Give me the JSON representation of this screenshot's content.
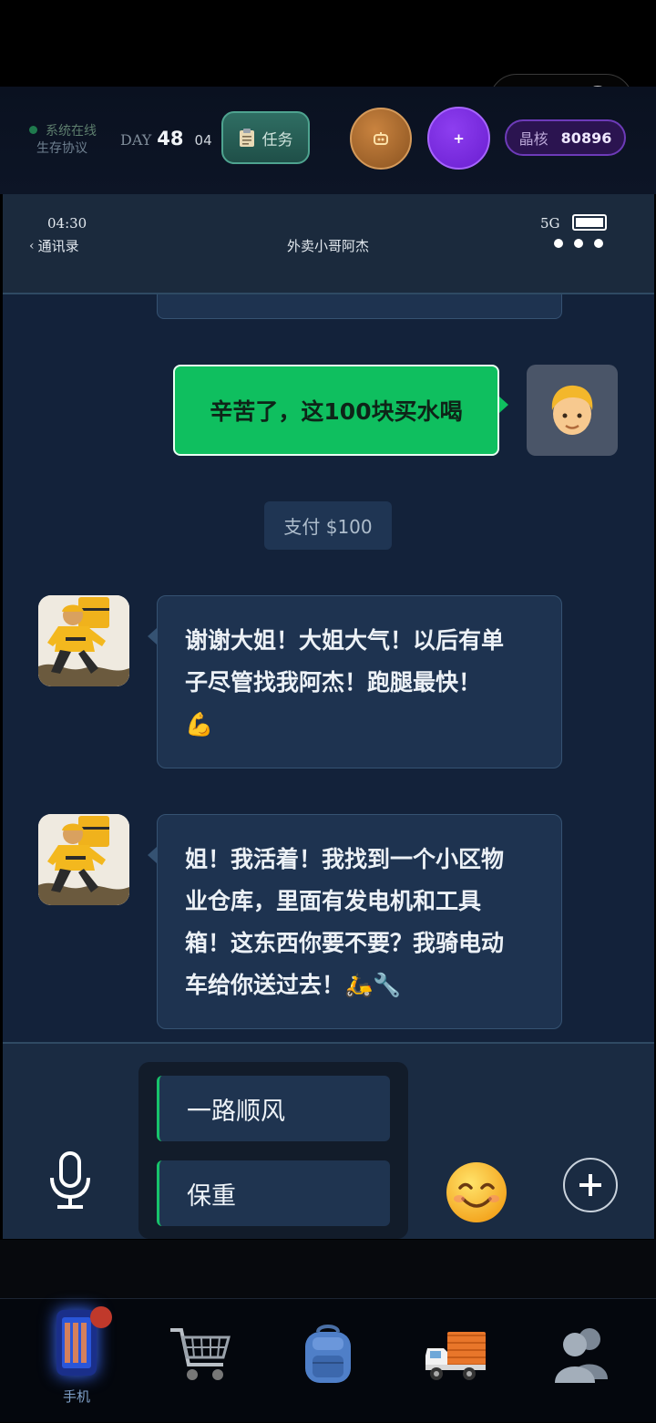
{
  "hud": {
    "status_text": "系统在线",
    "protocol_text": "生存协议",
    "day_label": "DAY",
    "day_number": "48",
    "day_sub": "04",
    "task_label": "任务",
    "plus_label": "+",
    "crystal_label": "晶核",
    "crystal_value": "80896"
  },
  "phone_header": {
    "time": "04:30",
    "back_label": "通讯录",
    "contact_name": "外卖小哥阿杰",
    "network": "5G"
  },
  "messages": [
    {
      "side": "out",
      "text": "辛苦了，这100块买水喝"
    },
    {
      "side": "system",
      "text": "支付 $100"
    },
    {
      "side": "in",
      "lines": [
        "谢谢大姐！大姐大气！以后有单",
        "子尽管找我阿杰！跑腿最快！",
        "💪"
      ]
    },
    {
      "side": "in",
      "lines": [
        "姐！我活着！我找到一个小区物",
        "业仓库，里面有发电机和工具",
        "箱！这东西你要不要？我骑电动",
        "车给你送过去！🛵🔧"
      ]
    }
  ],
  "quick_replies": [
    "一路顺风",
    "保重"
  ],
  "nav": {
    "items": [
      {
        "label": "手机",
        "icon": "phone-icon",
        "active": true
      },
      {
        "label": "",
        "icon": "cart-icon"
      },
      {
        "label": "",
        "icon": "backpack-icon"
      },
      {
        "label": "",
        "icon": "truck-icon"
      },
      {
        "label": "",
        "icon": "contacts-icon"
      }
    ]
  },
  "colors": {
    "accent_green": "#17c36b",
    "bubble_out": "#0fbf5f",
    "bubble_in": "#1e3350",
    "badge_red": "#c0392b"
  }
}
